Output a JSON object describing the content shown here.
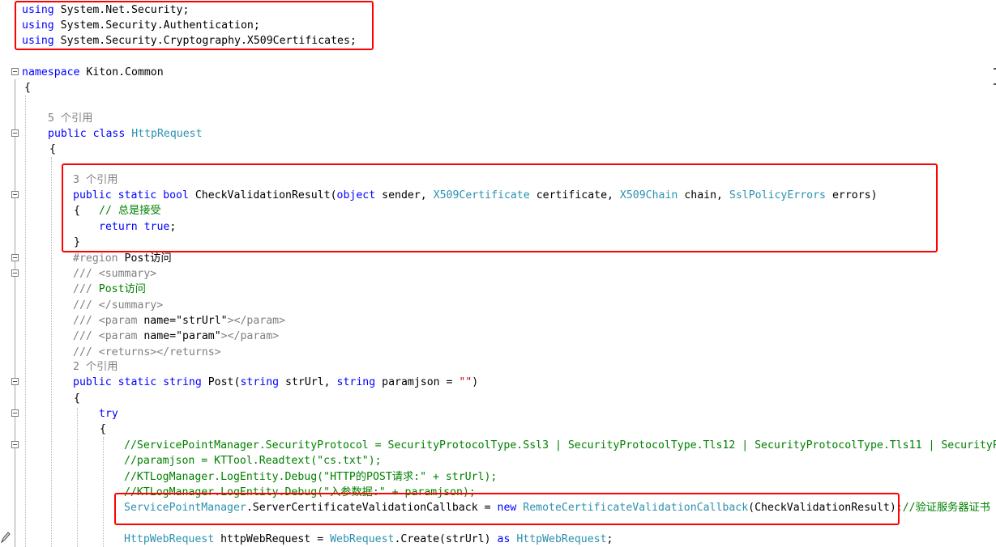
{
  "editor": {
    "language": "C#",
    "colors": {
      "keyword": "#0000ff",
      "type": "#2b91af",
      "comment": "#008000",
      "string": "#a31515",
      "xml_doc": "#808080",
      "highlight_box": "#ff0000"
    },
    "usings": {
      "line1": {
        "kw": "using",
        "ns": " System.Net.Security;"
      },
      "line2": {
        "kw": "using",
        "ns": " System.Security.Authentication;"
      },
      "line3": {
        "kw": "using",
        "ns": " System.Security.Cryptography.X509Certificates;"
      }
    },
    "namespace_line": {
      "kw": "namespace",
      "name": " Kiton.Common"
    },
    "brace_open": "{",
    "brace_close": "}",
    "class_refs": "5 个引用",
    "class_decl": {
      "kw": "public class ",
      "name": "HttpRequest"
    },
    "method1_refs": "3 个引用",
    "method1_sig": {
      "mods": "public static bool",
      "name": " CheckValidationResult(",
      "p1_type": "object",
      "p1_name": " sender, ",
      "p2_type": "X509Certificate",
      "p2_name": " certificate, ",
      "p3_type": "X509Chain",
      "p3_name": " chain, ",
      "p4_type": "SslPolicyErrors",
      "p4_name": " errors)"
    },
    "method1_comment": "// 总是接受",
    "method1_return": {
      "kw": "return true",
      "end": ";"
    },
    "region_line": {
      "kw": "#region",
      "text": " Post访问"
    },
    "doc1": {
      "slashes": "///",
      "tag": " <summary>"
    },
    "doc2": {
      "slashes": "///",
      "text": " Post访问"
    },
    "doc3": {
      "slashes": "///",
      "tag": " </summary>"
    },
    "doc4": {
      "slashes": "///",
      "open": " <param ",
      "attr": "name=",
      "val": "\"strUrl\"",
      "close": "></param>"
    },
    "doc5": {
      "slashes": "///",
      "open": " <param ",
      "attr": "name=",
      "val": "\"param\"",
      "close": "></param>"
    },
    "doc6": {
      "slashes": "///",
      "tag": " <returns></returns>"
    },
    "method2_refs": "2 个引用",
    "method2_sig": {
      "mods": "public static string",
      "name": " Post(",
      "p1_type": "string",
      "p1_name": " strUrl, ",
      "p2_type": "string",
      "p2_name": " paramjson = ",
      "p2_default": "\"\"",
      "end": ")"
    },
    "try_kw": "try",
    "comment1": "//ServicePointManager.SecurityProtocol = SecurityProtocolType.Ssl3 | SecurityProtocolType.Tls12 | SecurityProtocolType.Tls11 | SecurityPr",
    "comment2": "//paramjson = KTTool.Readtext(\"cs.txt\");",
    "comment3": "//KTLogManager.LogEntity.Debug(\"HTTP的POST请求:\" + strUrl);",
    "comment4": "//KTLogManager.LogEntity.Debug(\"入参数据:\" + paramjson);",
    "callback_line": {
      "type1": "ServicePointManager",
      "member": ".ServerCertificateValidationCallback = ",
      "kw": "new ",
      "type2": "RemoteCertificateValidationCallback",
      "arg": "(CheckValidationResult);",
      "comment": "//验证服务器证书"
    },
    "request_line": {
      "type1": "HttpWebRequest",
      "var": " httpWebRequest = ",
      "type2": "WebRequest",
      "call": ".Create(strUrl) ",
      "kw": "as ",
      "type3": "HttpWebRequest",
      "end": ";"
    }
  }
}
